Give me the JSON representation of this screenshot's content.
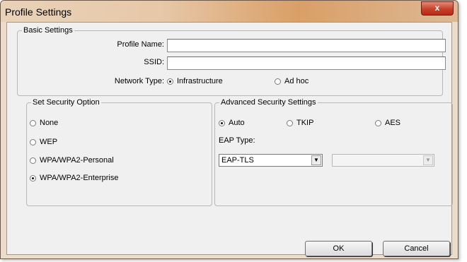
{
  "window": {
    "title": "Profile Settings",
    "close_glyph": "x"
  },
  "basic": {
    "legend": "Basic Settings",
    "profile_name_label": "Profile Name:",
    "profile_name_value": "",
    "ssid_label": "SSID:",
    "ssid_value": "",
    "network_type_label": "Network Type:",
    "network_types": [
      {
        "label": "Infrastructure",
        "selected": true
      },
      {
        "label": "Ad hoc",
        "selected": false
      }
    ]
  },
  "security": {
    "legend": "Set Security Option",
    "options": [
      {
        "label": "None",
        "selected": false
      },
      {
        "label": "WEP",
        "selected": false
      },
      {
        "label": "WPA/WPA2-Personal",
        "selected": false
      },
      {
        "label": "WPA/WPA2-Enterprise",
        "selected": true
      }
    ]
  },
  "advanced": {
    "legend": "Advanced Security Settings",
    "ciphers": [
      {
        "label": "Auto",
        "selected": true
      },
      {
        "label": "TKIP",
        "selected": false
      },
      {
        "label": "AES",
        "selected": false
      }
    ],
    "eap_type_label": "EAP Type:",
    "eap_type_value": "EAP-TLS",
    "secondary_value": ""
  },
  "buttons": {
    "ok": "OK",
    "cancel": "Cancel"
  },
  "icons": {
    "dropdown": "triangle-down"
  },
  "colors": {
    "titlebar_accent": "#d99f67",
    "close_button": "#c8402a",
    "dialog_bg": "#f0f0f0"
  }
}
